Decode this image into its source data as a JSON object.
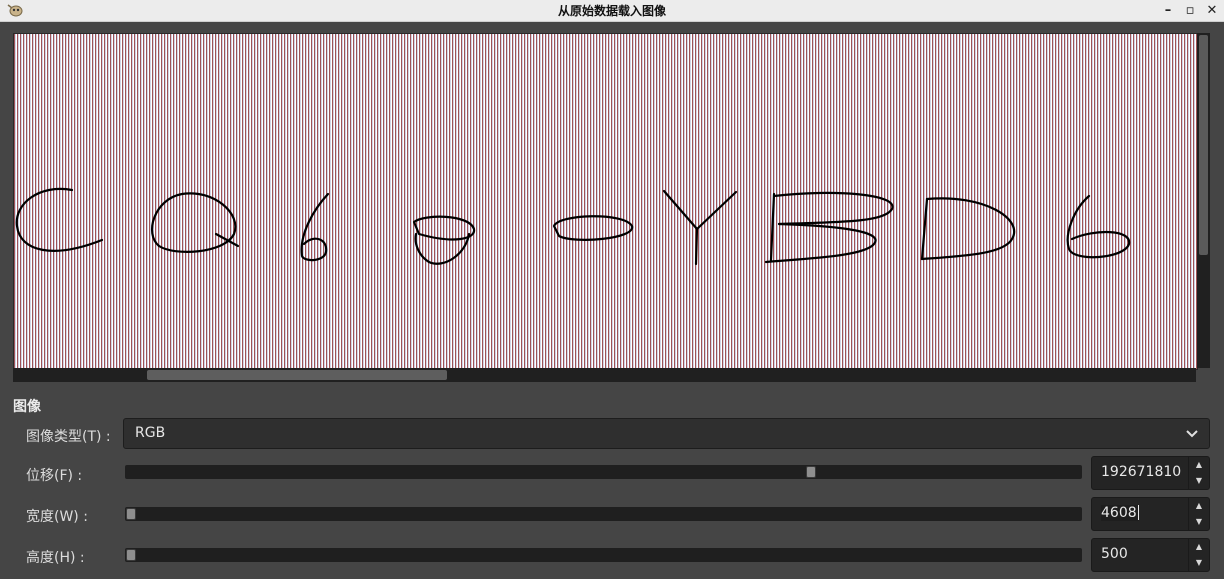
{
  "window": {
    "title": "从原始数据载入图像",
    "minimize_glyph": "–",
    "maximize_glyph": "▫",
    "close_glyph": "✕"
  },
  "preview": {
    "stripe_colors": [
      "#9e5257",
      "#cfd3e6",
      "#ffffff"
    ],
    "text_color": "#000000"
  },
  "section": {
    "title": "图像"
  },
  "image_type": {
    "label": "图像类型(T) :",
    "value": "RGB",
    "arrow_icon": "chevron-down-icon"
  },
  "offset": {
    "label": "位移(F) :",
    "value": "192671810",
    "slider_fraction": 0.72
  },
  "width": {
    "label": "宽度(W) :",
    "value": "4608",
    "slider_fraction": 0.0
  },
  "height": {
    "label": "高度(H) :",
    "value": "500",
    "slider_fraction": 0.0
  },
  "spin": {
    "up_glyph": "▲",
    "down_glyph": "▼"
  }
}
